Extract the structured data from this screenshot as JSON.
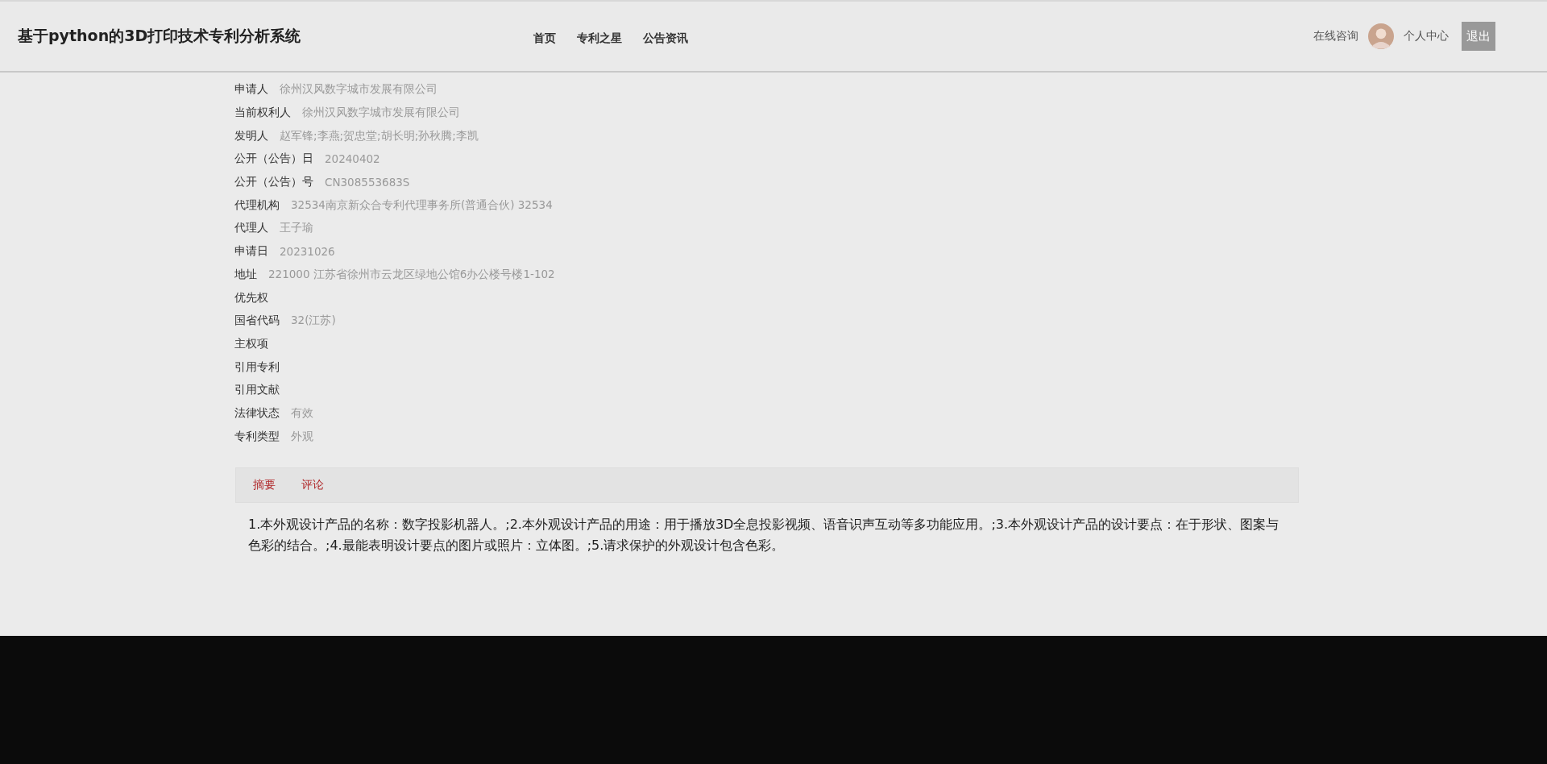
{
  "header": {
    "title": "基于python的3D打印技术专利分析系统",
    "nav": [
      "首页",
      "专利之星",
      "公告资讯"
    ],
    "consult": "在线咨询",
    "user_center": "个人中心",
    "logout": "退出"
  },
  "details": [
    {
      "label": "申请人",
      "value": "徐州汉风数字城市发展有限公司"
    },
    {
      "label": "当前权利人",
      "value": "徐州汉风数字城市发展有限公司"
    },
    {
      "label": "发明人",
      "value": "赵军锋;李燕;贺忠堂;胡长明;孙秋腾;李凯"
    },
    {
      "label": "公开（公告）日",
      "value": "20240402"
    },
    {
      "label": "公开（公告）号",
      "value": "CN308553683S"
    },
    {
      "label": "代理机构",
      "value": "32534南京新众合专利代理事务所(普通合伙) 32534"
    },
    {
      "label": "代理人",
      "value": "王子瑜"
    },
    {
      "label": "申请日",
      "value": "20231026"
    },
    {
      "label": "地址",
      "value": "221000 江苏省徐州市云龙区绿地公馆6办公楼号楼1-102"
    },
    {
      "label": "优先权"
    },
    {
      "label": "国省代码",
      "value": "32(江苏)"
    },
    {
      "label": "主权项"
    },
    {
      "label": "引用专利"
    },
    {
      "label": "引用文献"
    },
    {
      "label": "法律状态",
      "value": "有效"
    },
    {
      "label": "专利类型",
      "value": "外观"
    }
  ],
  "tabs": [
    "摘要",
    "评论"
  ],
  "abstract": "1.本外观设计产品的名称：数字投影机器人。;2.本外观设计产品的用途：用于播放3D全息投影视频、语音识声互动等多功能应用。;3.本外观设计产品的设计要点：在于形状、图案与色彩的结合。;4.最能表明设计要点的图片或照片：立体图。;5.请求保护的外观设计包含色彩。"
}
